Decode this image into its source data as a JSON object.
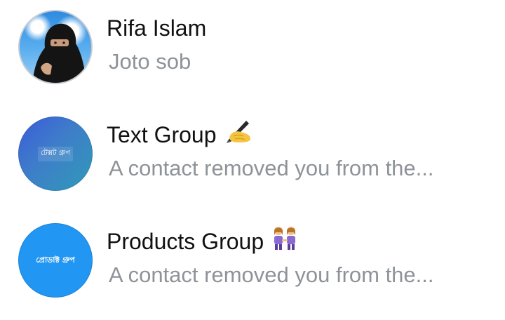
{
  "chats": [
    {
      "name": "Rifa Islam",
      "preview": "Joto sob",
      "avatar": "profile-photo",
      "emoji": ""
    },
    {
      "name": "Text Group",
      "preview": "A contact removed you from the...",
      "avatar_label": "টেক্সট গ্রুপ",
      "emoji": "writing-hand-emoji"
    },
    {
      "name": "Products Group",
      "preview": "A contact removed you from the...",
      "avatar_label": "প্রোডাক্ট গ্রুপ",
      "emoji": "two-women-emoji"
    }
  ],
  "colors": {
    "name_text": "#111111",
    "preview_text": "#8e9399",
    "text_group_avatar": "#3e6fd0",
    "products_group_avatar": "#2196f3"
  }
}
